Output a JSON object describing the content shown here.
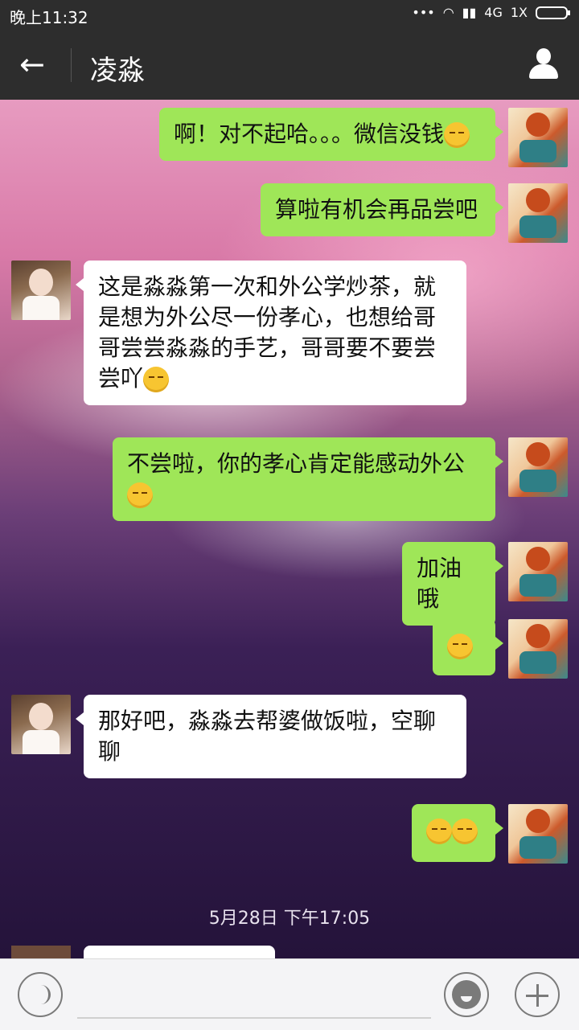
{
  "status_bar": {
    "time": "晚上11:32",
    "signal_label": "4G",
    "sim_label": "1X"
  },
  "header": {
    "back_label": "←",
    "title": "凌淼"
  },
  "messages": [
    {
      "side": "right",
      "text": "啊！对不起哈。。。微信没钱"
    },
    {
      "side": "right",
      "text": "算啦有机会再品尝吧"
    },
    {
      "side": "left",
      "text": "这是淼淼第一次和外公学炒茶，就是想为外公尽一份孝心，也想给哥哥尝尝淼淼的手艺，哥哥要不要尝尝吖"
    },
    {
      "side": "right",
      "text": "不尝啦，你的孝心肯定能感动外公"
    },
    {
      "side": "right",
      "text": "加油哦"
    },
    {
      "side": "right",
      "text": ""
    },
    {
      "side": "left",
      "text": "那好吧，淼淼去帮婆做饭啦，空聊聊"
    },
    {
      "side": "right",
      "text": ""
    }
  ],
  "timestamp": "5月28日 下午17:05",
  "colors": {
    "my_bubble": "#9fe658",
    "their_bubble": "#ffffff",
    "bar": "#2d2d2d"
  }
}
